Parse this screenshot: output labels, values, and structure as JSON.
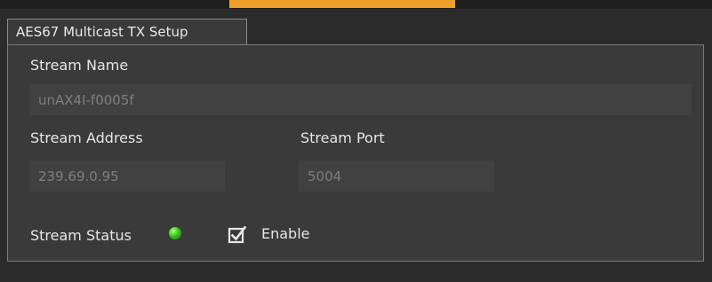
{
  "tab": {
    "title": "AES67 Multicast TX Setup"
  },
  "stream_name": {
    "label": "Stream Name",
    "value": "unAX4I-f0005f"
  },
  "stream_address": {
    "label": "Stream Address",
    "value": "239.69.0.95"
  },
  "stream_port": {
    "label": "Stream Port",
    "value": "5004"
  },
  "stream_status": {
    "label": "Stream Status",
    "indicator_color": "#36c51d"
  },
  "enable": {
    "label": "Enable",
    "checked": true
  },
  "colors": {
    "accent": "#f0a028",
    "panel_bg": "#3a3a3a",
    "field_bg": "#414141"
  }
}
